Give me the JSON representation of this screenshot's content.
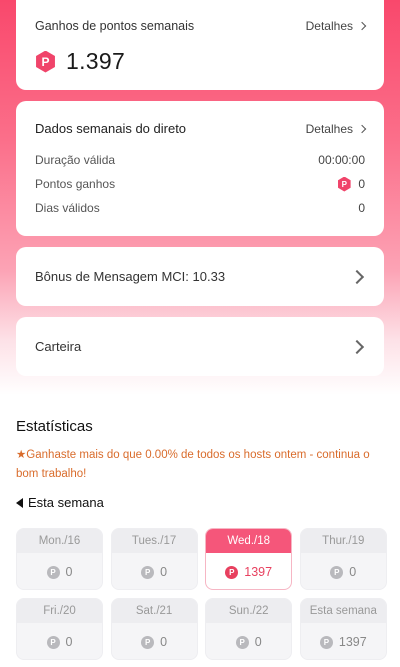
{
  "points_card": {
    "title": "Ganhos de pontos semanais",
    "details_label": "Detalhes",
    "points_icon_letter": "P",
    "total_points": "1.397"
  },
  "live_card": {
    "title": "Dados semanais do direto",
    "details_label": "Detalhes",
    "rows": [
      {
        "label": "Duração válida",
        "value": "00:00:00"
      },
      {
        "label": "Pontos ganhos",
        "value": "0"
      },
      {
        "label": "Dias válidos",
        "value": "0"
      }
    ]
  },
  "bonus_card": {
    "label": "Bônus de Mensagem MCI: 10.33"
  },
  "wallet_card": {
    "label": "Carteira"
  },
  "stats": {
    "title": "Estatísticas",
    "message": "★Ganhaste mais do que 0.00% de todos os hosts ontem - continua o bom trabalho!",
    "week_label": "Esta semana",
    "coin_letter": "P",
    "days": [
      {
        "label": "Mon./16",
        "value": "0",
        "active": false
      },
      {
        "label": "Tues./17",
        "value": "0",
        "active": false
      },
      {
        "label": "Wed./18",
        "value": "1397",
        "active": true
      },
      {
        "label": "Thur./19",
        "value": "0",
        "active": false
      },
      {
        "label": "Fri./20",
        "value": "0",
        "active": false
      },
      {
        "label": "Sat./21",
        "value": "0",
        "active": false
      },
      {
        "label": "Sun./22",
        "value": "0",
        "active": false
      },
      {
        "label": "Esta semana",
        "value": "1397",
        "active": false
      }
    ]
  },
  "colors": {
    "brand_pink": "#f9486c",
    "accent_orange": "#d96c2c",
    "active_day": "#f5567a"
  }
}
